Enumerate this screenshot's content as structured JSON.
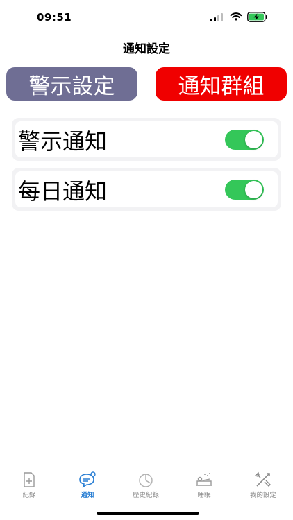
{
  "status_bar": {
    "time": "09:51"
  },
  "nav": {
    "title": "通知設定"
  },
  "buttons": {
    "alert_settings": "警示設定",
    "notification_groups": "通知群組"
  },
  "settings": [
    {
      "label": "警示通知",
      "enabled": true
    },
    {
      "label": "每日通知",
      "enabled": true
    }
  ],
  "tabs": [
    {
      "label": "紀錄",
      "icon": "record-icon",
      "active": false
    },
    {
      "label": "通知",
      "icon": "notification-icon",
      "active": true
    },
    {
      "label": "歷史紀錄",
      "icon": "history-icon",
      "active": false
    },
    {
      "label": "睡眠",
      "icon": "sleep-icon",
      "active": false
    },
    {
      "label": "我的設定",
      "icon": "settings-tools-icon",
      "active": false
    }
  ],
  "colors": {
    "alert_button": "#6f6e94",
    "group_button": "#f00000",
    "toggle_on": "#34c759",
    "active_tab": "#2a7fd4",
    "inactive_tab": "#8a8a8a"
  }
}
